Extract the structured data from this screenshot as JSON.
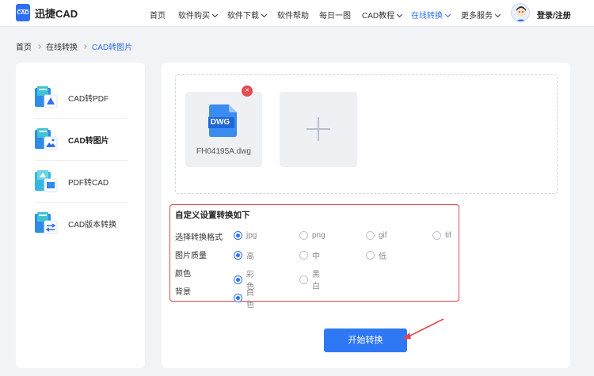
{
  "brand": {
    "name": "迅捷CAD",
    "logo_text": "CAD"
  },
  "nav": {
    "items": [
      {
        "label": "首页",
        "dropdown": false,
        "active": false
      },
      {
        "label": "软件购买",
        "dropdown": true,
        "active": false
      },
      {
        "label": "软件下载",
        "dropdown": true,
        "active": false
      },
      {
        "label": "软件帮助",
        "dropdown": false,
        "active": false
      },
      {
        "label": "每日一图",
        "dropdown": false,
        "active": false
      },
      {
        "label": "CAD教程",
        "dropdown": true,
        "active": false
      },
      {
        "label": "在线转换",
        "dropdown": true,
        "active": true
      },
      {
        "label": "更多服务",
        "dropdown": true,
        "active": false
      }
    ],
    "login": "登录/注册"
  },
  "breadcrumb": [
    "首页",
    "在线转换",
    "CAD转图片"
  ],
  "sidebar": {
    "items": [
      {
        "label": "CAD转PDF",
        "active": false,
        "icon": "cad-to-pdf-icon"
      },
      {
        "label": "CAD转图片",
        "active": true,
        "icon": "cad-to-image-icon"
      },
      {
        "label": "PDF转CAD",
        "active": false,
        "icon": "pdf-to-cad-icon"
      },
      {
        "label": "CAD版本转换",
        "active": false,
        "icon": "cad-version-icon"
      }
    ]
  },
  "upload": {
    "file": {
      "name": "FH04195A.dwg",
      "type_badge": "DWG",
      "remove_symbol": "×"
    }
  },
  "settings": {
    "title": "自定义设置转换如下",
    "rows": [
      {
        "label": "选择转换格式",
        "options": [
          "jpg",
          "png",
          "gif",
          "tif"
        ],
        "selected": "jpg"
      },
      {
        "label": "图片质量",
        "options": [
          "高",
          "中",
          "低"
        ],
        "selected": "高"
      },
      {
        "label": "颜色",
        "options": [
          "彩色",
          "黑白"
        ],
        "selected": "彩色"
      },
      {
        "label": "背景",
        "options": [
          "白色"
        ],
        "selected": "白色"
      }
    ]
  },
  "actions": {
    "start_label": "开始转换"
  },
  "colors": {
    "accent": "#2f6ff5",
    "danger": "#e8484f",
    "highlight_box": "#e0474c"
  }
}
